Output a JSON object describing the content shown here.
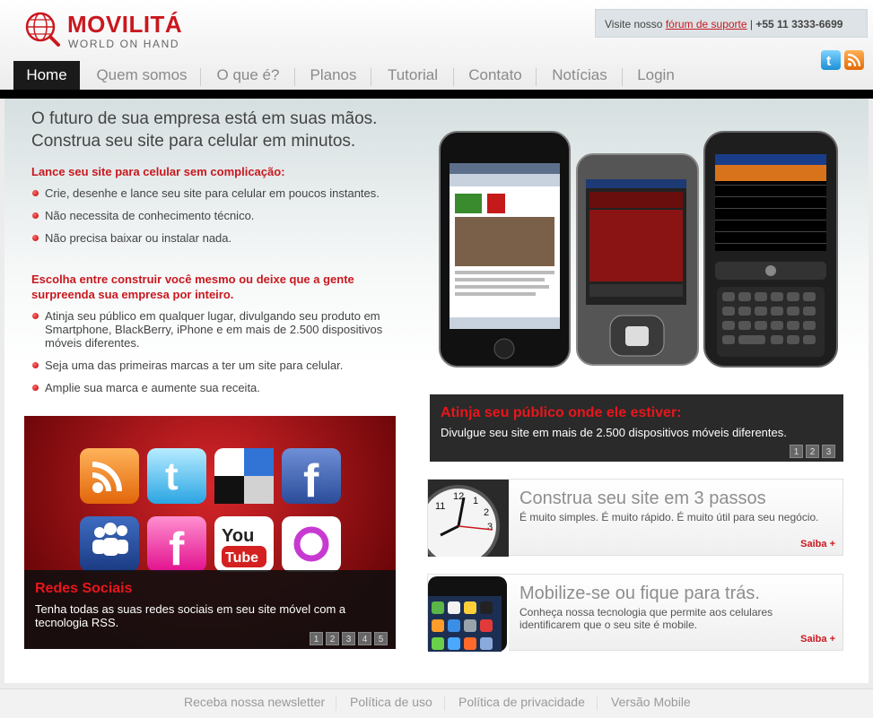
{
  "brand": {
    "name": "MOVILITÁ",
    "tagline": "WORLD ON HAND"
  },
  "support": {
    "prefix": "Visite nosso",
    "link": "fórum de suporte",
    "separator": "|",
    "phone": "+55 11 3333-6699"
  },
  "social_icons": [
    "twitter-icon",
    "rss-icon"
  ],
  "nav": [
    "Home",
    "Quem somos",
    "O que é?",
    "Planos",
    "Tutorial",
    "Contato",
    "Notícias",
    "Login"
  ],
  "hero": {
    "headline_1": "O futuro de sua empresa está em suas mãos.",
    "headline_2": "Construa seu site para celular em minutos.",
    "sub1": "Lance seu site para celular sem complicação:",
    "list1": [
      "Crie, desenhe e lance seu site para celular em poucos instantes.",
      "Não necessita de conhecimento técnico.",
      "Não precisa baixar ou instalar nada."
    ],
    "sub2": "Escolha entre construir você mesmo ou deixe que a gente surpreenda sua empresa por inteiro.",
    "list2": [
      "Atinja seu público em qualquer lugar, divulgando seu produto em Smartphone, BlackBerry, iPhone e em mais de 2.500 dispositivos móveis diferentes.",
      "Seja uma das primeiras marcas a ter um site para celular.",
      "Amplie sua marca e aumente sua receita."
    ]
  },
  "social_slider": {
    "title": "Redes Sociais",
    "text": "Tenha todas as suas redes sociais em seu site móvel com a tecnologia RSS.",
    "pages": [
      "1",
      "2",
      "3",
      "4",
      "5"
    ]
  },
  "reach_slider": {
    "title": "Atinja seu público onde ele estiver:",
    "text": "Divulgue seu site em mais de 2.500 dispositivos móveis diferentes.",
    "pages": [
      "1",
      "2",
      "3"
    ]
  },
  "promos": [
    {
      "title": "Construa seu site em 3 passos",
      "text": "É muito simples. É muito rápido. É muito útil para seu negócio.",
      "more": "Saiba +"
    },
    {
      "title": "Mobilize-se ou fique para trás.",
      "text": "Conheça nossa tecnologia que permite aos celulares identificarem que o seu site é mobile.",
      "more": "Saiba +"
    }
  ],
  "footer": [
    "Receba nossa newsletter",
    "Política de uso",
    "Política de privacidade",
    "Versão Mobile"
  ],
  "colors": {
    "brand_red": "#c9181f",
    "nav_active": "#1a1a1a"
  }
}
